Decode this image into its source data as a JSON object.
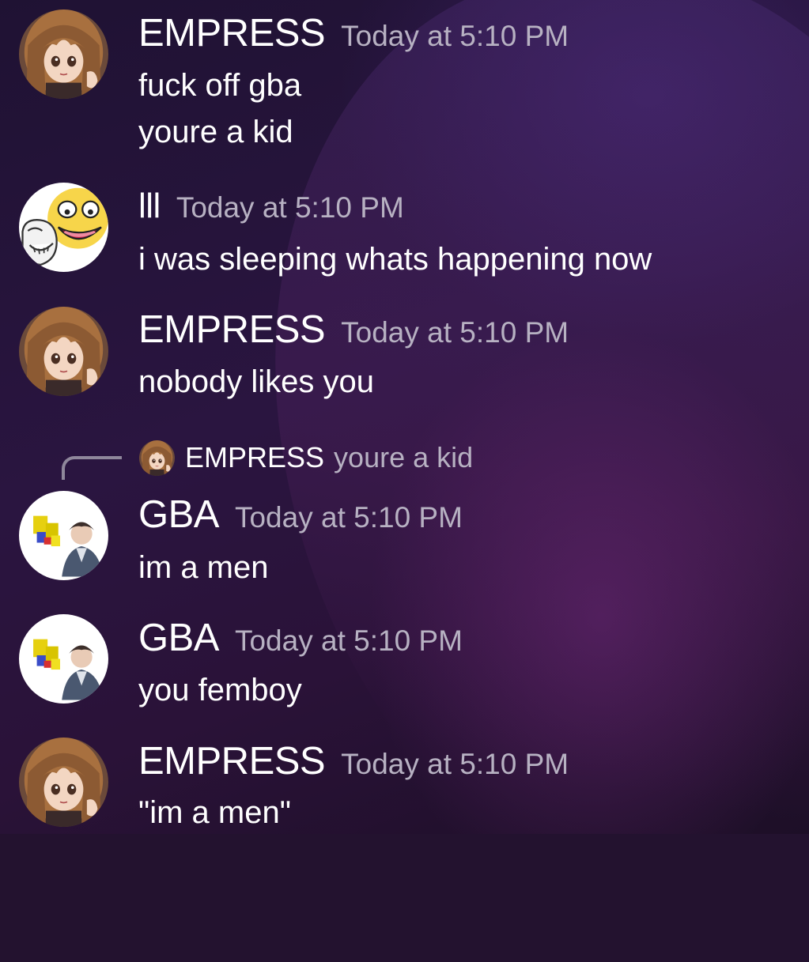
{
  "messages": [
    {
      "author": "EMPRESS",
      "timestamp": "Today at 5:10 PM",
      "lines": [
        "fuck off gba",
        "youre a kid"
      ],
      "avatar": "anime-girl-avatar"
    },
    {
      "author": "lll",
      "timestamp": "Today at 5:10 PM",
      "lines": [
        "i was sleeping whats happening now"
      ],
      "avatar": "meme-faces-avatar"
    },
    {
      "author": "EMPRESS",
      "timestamp": "Today at 5:10 PM",
      "lines": [
        "nobody likes you"
      ],
      "avatar": "anime-girl-avatar"
    },
    {
      "author": "GBA",
      "timestamp": "Today at 5:10 PM",
      "lines": [
        "im a men"
      ],
      "avatar": "gba-avatar",
      "reply_to": {
        "author": "EMPRESS",
        "content": "youre a kid"
      }
    },
    {
      "author": "GBA",
      "timestamp": "Today at 5:10 PM",
      "lines": [
        "you femboy"
      ],
      "avatar": "gba-avatar"
    },
    {
      "author": "EMPRESS",
      "timestamp": "Today at 5:10 PM",
      "lines": [
        "\"im a men\""
      ],
      "avatar": "anime-girl-avatar"
    }
  ],
  "colors": {
    "username": "#ffffff",
    "timestamp": "#b7b1c2",
    "message_text": "#ffffff",
    "reply_line": "#8f879b",
    "background": "#23122f"
  }
}
